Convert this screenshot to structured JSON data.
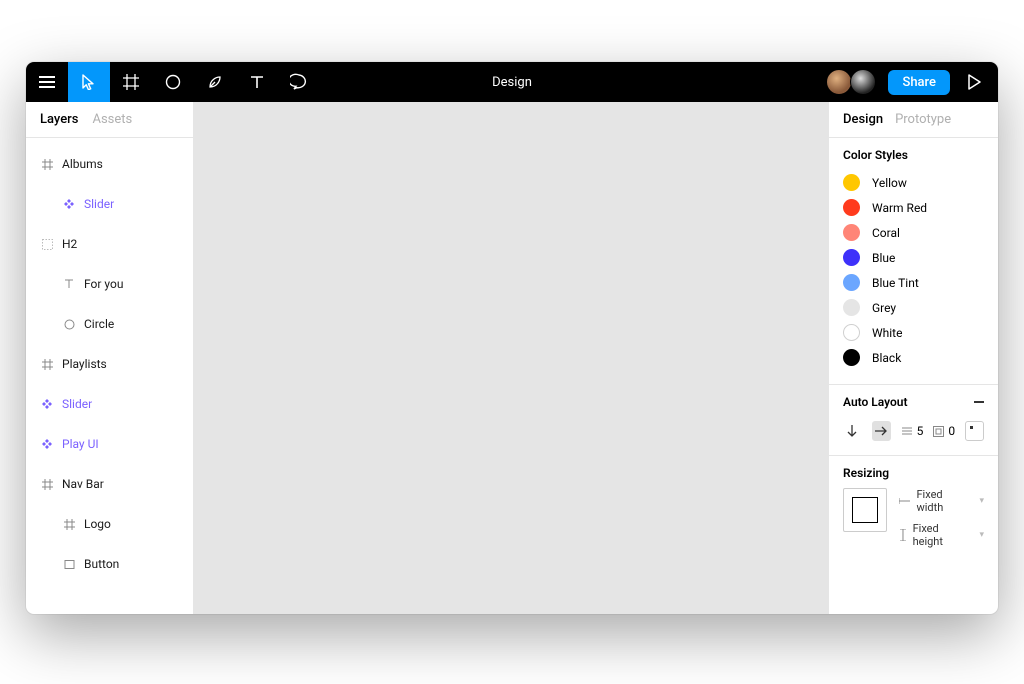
{
  "toolbar": {
    "title": "Design",
    "share_label": "Share"
  },
  "left": {
    "tabs": {
      "layers": "Layers",
      "assets": "Assets"
    },
    "layers": [
      {
        "label": "Albums"
      },
      {
        "label": "Slider"
      },
      {
        "label": "H2"
      },
      {
        "label": "For you"
      },
      {
        "label": "Circle"
      },
      {
        "label": "Playlists"
      },
      {
        "label": "Slider"
      },
      {
        "label": "Play UI"
      },
      {
        "label": "Nav Bar"
      },
      {
        "label": "Logo"
      },
      {
        "label": "Button"
      }
    ]
  },
  "right": {
    "tabs": {
      "design": "Design",
      "prototype": "Prototype"
    },
    "color_styles_title": "Color Styles",
    "colors": [
      {
        "name": "Yellow",
        "hex": "#FFC700"
      },
      {
        "name": "Warm Red",
        "hex": "#FF3B1D"
      },
      {
        "name": "Coral",
        "hex": "#FF8577"
      },
      {
        "name": "Blue",
        "hex": "#3E31FA"
      },
      {
        "name": "Blue Tint",
        "hex": "#6BA6FF"
      },
      {
        "name": "Grey",
        "hex": "#E5E5E5"
      },
      {
        "name": "White",
        "hex": "#FFFFFF"
      },
      {
        "name": "Black",
        "hex": "#000000"
      }
    ],
    "auto_layout": {
      "title": "Auto Layout",
      "spacing": "5",
      "padding": "0"
    },
    "resizing": {
      "title": "Resizing",
      "width_mode": "Fixed width",
      "height_mode": "Fixed height"
    }
  }
}
